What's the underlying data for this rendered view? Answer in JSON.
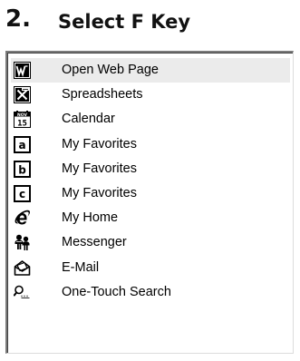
{
  "header": {
    "step_number": "2.",
    "title": "Select F Key"
  },
  "list": {
    "selected_index": 0,
    "items": [
      {
        "label": "Open Web Page",
        "icon": "word-w-icon"
      },
      {
        "label": "Spreadsheets",
        "icon": "excel-x-icon"
      },
      {
        "label": "Calendar",
        "icon": "calendar-icon"
      },
      {
        "label": "My Favorites",
        "icon": "letter-a-icon"
      },
      {
        "label": "My Favorites",
        "icon": "letter-b-icon"
      },
      {
        "label": "My Favorites",
        "icon": "letter-c-icon"
      },
      {
        "label": "My Home",
        "icon": "internet-explorer-icon"
      },
      {
        "label": "Messenger",
        "icon": "messenger-icon"
      },
      {
        "label": "E-Mail",
        "icon": "email-envelope-icon"
      },
      {
        "label": "One-Touch Search",
        "icon": "search-magnifier-icon"
      }
    ]
  },
  "calendar_icon": {
    "month": "NOV",
    "day": "15"
  },
  "letter_icons": {
    "a": "a",
    "b": "b",
    "c": "c"
  }
}
